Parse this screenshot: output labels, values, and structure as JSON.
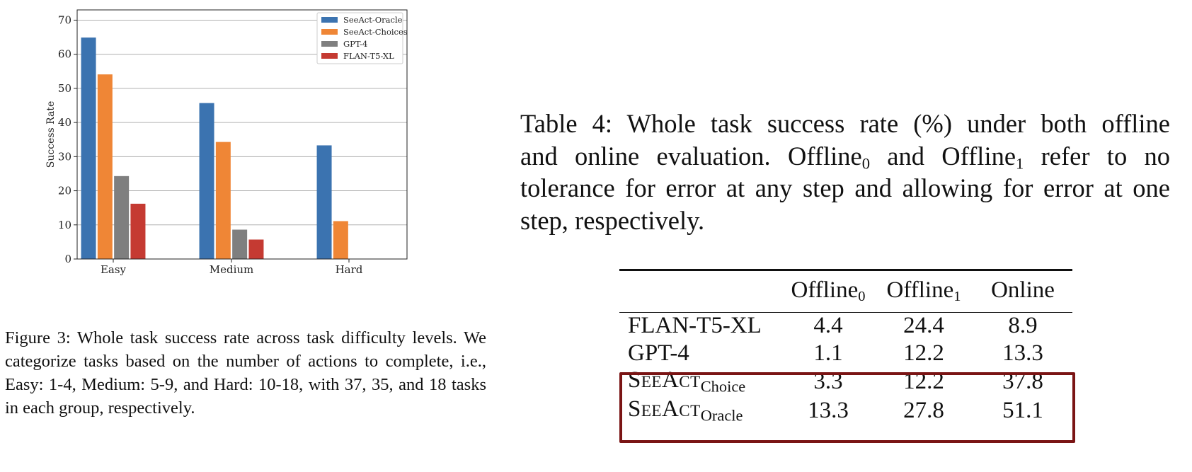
{
  "figure": {
    "caption_label": "Figure 3:",
    "caption_text": "Whole task success rate across task difficulty levels. We categorize tasks based on the number of actions to complete, i.e., Easy: 1-4, Medium: 5-9, and Hard: 10-18, with 37, 35, and 18 tasks in each group, respectively."
  },
  "chart_data": {
    "type": "bar",
    "categories": [
      "Easy",
      "Medium",
      "Hard"
    ],
    "series": [
      {
        "name": "SeeAct-Oracle",
        "values": [
          64.9,
          45.7,
          33.3
        ],
        "color": "#3b73b0"
      },
      {
        "name": "SeeAct-Choices",
        "values": [
          54.1,
          34.3,
          11.1
        ],
        "color": "#ef8636"
      },
      {
        "name": "GPT-4",
        "values": [
          24.3,
          8.6,
          0
        ],
        "color": "#7f7f7f"
      },
      {
        "name": "FLAN-T5-XL",
        "values": [
          16.2,
          5.7,
          0
        ],
        "color": "#c53a32"
      }
    ],
    "ylabel": "Success Rate",
    "xlabel": "",
    "ylim": [
      0,
      73
    ],
    "yticks": [
      0,
      10,
      20,
      30,
      40,
      50,
      60,
      70
    ],
    "grid": true,
    "legend_position": "top-right"
  },
  "table": {
    "caption_lines": [
      [
        "Table 4:  Whole task success rate (%) under both offline"
      ],
      [
        "and online evaluation.  Offline",
        "0",
        " and Offline",
        "1",
        " refer to no"
      ],
      [
        "tolerance for error at any step and allowing for error at one"
      ],
      [
        "step, respectively."
      ]
    ],
    "headers": [
      {
        "base": "Offline",
        "sub": "0"
      },
      {
        "base": "Offline",
        "sub": "1"
      },
      {
        "base": "Online",
        "sub": ""
      }
    ],
    "rows": [
      {
        "model": "FLAN-T5-XL",
        "sc": false,
        "values": [
          "4.4",
          "24.4",
          "8.9"
        ]
      },
      {
        "model": "GPT-4",
        "sc": false,
        "values": [
          "1.1",
          "12.2",
          "13.3"
        ]
      },
      {
        "model": "SeeAct",
        "sc": true,
        "variant": "Choice",
        "values": [
          "3.3",
          "12.2",
          "37.8"
        ]
      },
      {
        "model": "SeeAct",
        "sc": true,
        "variant": "Oracle",
        "values": [
          "13.3",
          "27.8",
          "51.1"
        ]
      }
    ],
    "highlight_color": "#7a1414"
  }
}
